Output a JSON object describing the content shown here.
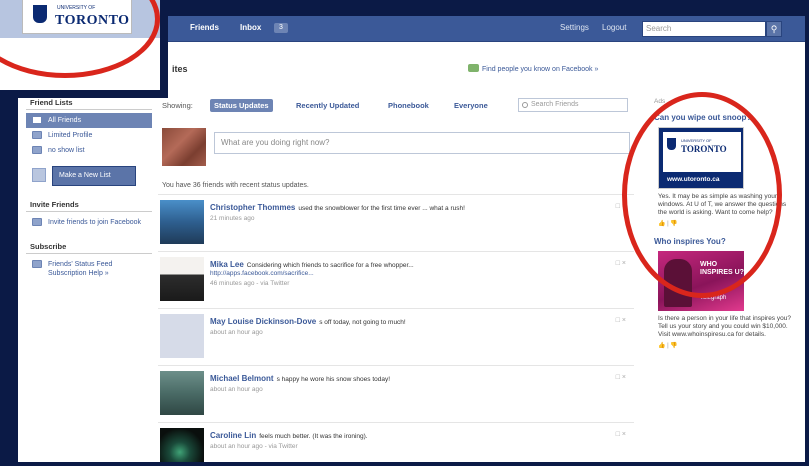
{
  "topbar": {
    "friends": "Friends",
    "inbox": "Inbox",
    "inbox_count": "3",
    "settings": "Settings",
    "logout": "Logout",
    "search_placeholder": "Search"
  },
  "page": {
    "heading": "ites",
    "find_people": "Find people you know on Facebook »"
  },
  "sidebar": {
    "friend_lists_heading": "Friend Lists",
    "lists": [
      {
        "label": "All Friends"
      },
      {
        "label": "Limited Profile"
      },
      {
        "label": "no show list"
      }
    ],
    "new_list_button": "Make a New List",
    "invite_heading": "Invite Friends",
    "invite_item": "Invite friends to join Facebook",
    "subscribe_heading": "Subscribe",
    "subscribe_item": "Friends' Status Feed Subscription Help »"
  },
  "filters": {
    "showing": "Showing:",
    "tabs": [
      "Status Updates",
      "Recently Updated",
      "Phonebook",
      "Everyone"
    ],
    "search_placeholder": "Search Friends"
  },
  "composer": {
    "placeholder": "What are you doing right now?",
    "friends_count": "You have 36 friends with recent status updates."
  },
  "feed": [
    {
      "name": "Christopher Thommes",
      "text": "used the snowblower for the first time ever ... what a rush!",
      "time": "21 minutes ago",
      "link": ""
    },
    {
      "name": "Mika Lee",
      "text": "Considering which friends to sacrifice for a free whopper...",
      "time": "46 minutes ago - via Twitter",
      "link": "http://apps.facebook.com/sacrifice..."
    },
    {
      "name": "May Louise Dickinson-Dove",
      "text": "s off today, not going to much!",
      "time": "about an hour ago",
      "link": ""
    },
    {
      "name": "Michael Belmont",
      "text": "s happy he wore his snow shoes today!",
      "time": "about an hour ago",
      "link": ""
    },
    {
      "name": "Caroline Lin",
      "text": "feels much better. (It was the ironing).",
      "time": "about an hour ago - via Twitter",
      "link": ""
    }
  ],
  "ads": {
    "label": "Ads",
    "ad1_title": "Can you wipe out snoop?",
    "ad1_logo_small": "UNIVERSITY OF",
    "ad1_logo_big": "TORONTO",
    "ad1_url": "www.utoronto.ca",
    "ad1_text": "Yes. It may be as simple as washing your windows. At U of T, we answer the questions the world is asking. Want to come help?",
    "ad1_actions": "👍 | 👎",
    "ad2_title": "Who inspires You?",
    "ad2_image_text": "WHO INSPIRES U?",
    "ad2_image_tag": "Telegraph",
    "ad2_text": "Is there a person in your life that inspires you? Tell us your story and you could win $10,000. Visit www.whoinspiresu.ca for details.",
    "ad2_actions": "👍 | 👎"
  },
  "inset": {
    "logo_small": "UNIVERSITY OF",
    "logo_big": "TORONTO"
  },
  "colors": {
    "facebook_blue": "#3b5998",
    "frame_navy": "#0b1a46",
    "highlight_red": "#d9261c"
  }
}
